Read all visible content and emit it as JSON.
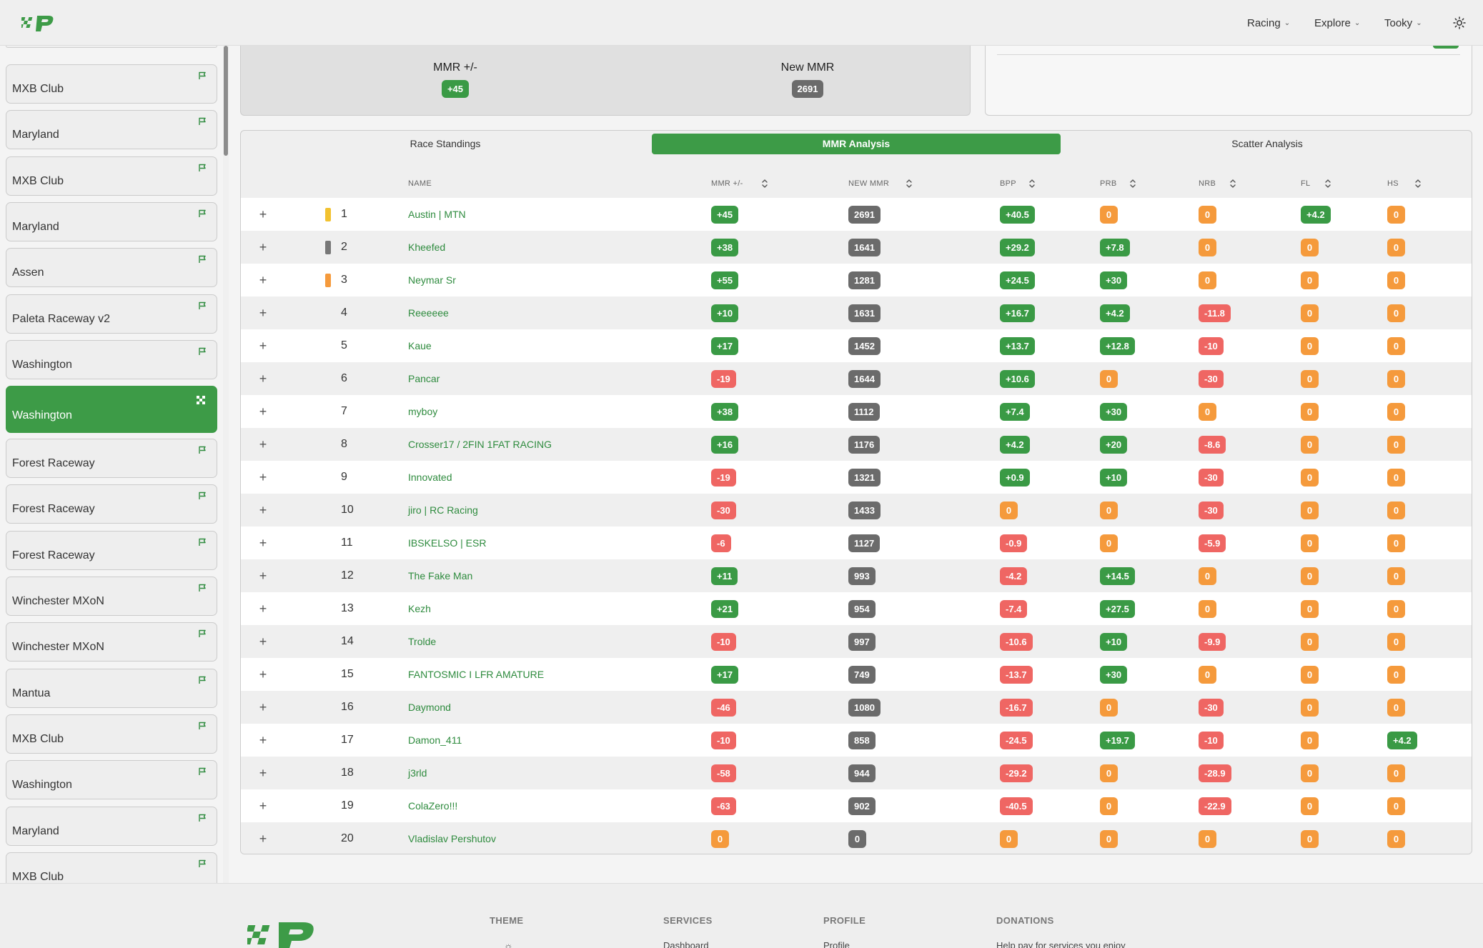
{
  "navbar": {
    "menu": [
      {
        "label": "Racing"
      },
      {
        "label": "Explore"
      },
      {
        "label": "Tooky"
      }
    ],
    "theme_icon": "sun-icon",
    "logo_icon": "checkered-p-logo"
  },
  "sidebar": {
    "tracks": [
      {
        "name": "MXB Club",
        "icon": "flag-icon"
      },
      {
        "name": "Maryland",
        "icon": "flag-icon"
      },
      {
        "name": "MXB Club",
        "icon": "flag-icon"
      },
      {
        "name": "Maryland",
        "icon": "flag-icon"
      },
      {
        "name": "Assen",
        "icon": "flag-icon"
      },
      {
        "name": "Paleta Raceway v2",
        "icon": "flag-icon"
      },
      {
        "name": "Washington",
        "icon": "flag-icon"
      },
      {
        "name": "Washington",
        "icon": "checkered-flag-icon",
        "active": true
      },
      {
        "name": "Forest Raceway",
        "icon": "flag-icon"
      },
      {
        "name": "Forest Raceway",
        "icon": "flag-icon"
      },
      {
        "name": "Forest Raceway",
        "icon": "flag-icon"
      },
      {
        "name": "Winchester MXoN",
        "icon": "flag-icon"
      },
      {
        "name": "Winchester MXoN",
        "icon": "flag-icon"
      },
      {
        "name": "Mantua",
        "icon": "flag-icon"
      },
      {
        "name": "MXB Club",
        "icon": "flag-icon"
      },
      {
        "name": "Washington",
        "icon": "flag-icon"
      },
      {
        "name": "Maryland",
        "icon": "flag-icon"
      },
      {
        "name": "MXB Club",
        "icon": "flag-icon"
      }
    ]
  },
  "summary": {
    "mmr_change_label": "MMR +/-",
    "mmr_change_value": "+45",
    "new_mmr_label": "New MMR",
    "new_mmr_value": "2691"
  },
  "tabs": [
    {
      "label": "Race Standings"
    },
    {
      "label": "MMR Analysis",
      "active": true
    },
    {
      "label": "Scatter Analysis"
    }
  ],
  "table": {
    "headers": {
      "name": "NAME",
      "mmr_change": "MMR +/-",
      "new_mmr": "NEW MMR",
      "bpp": "BPP",
      "prb": "PRB",
      "nrb": "NRB",
      "fl": "FL",
      "hs": "HS"
    },
    "expand_symbol": "+",
    "rows": [
      {
        "pos": "1",
        "marker": "#f2c230",
        "name": "Austin | MTN",
        "mmr": "+45",
        "new": "2691",
        "bpp": "+40.5",
        "prb": "0",
        "nrb": "0",
        "fl": "+4.2",
        "hs": "0"
      },
      {
        "pos": "2",
        "marker": "#777777",
        "name": "Kheefed",
        "mmr": "+38",
        "new": "1641",
        "bpp": "+29.2",
        "prb": "+7.8",
        "nrb": "0",
        "fl": "0",
        "hs": "0"
      },
      {
        "pos": "3",
        "marker": "#f59a3c",
        "name": "Neymar Sr",
        "mmr": "+55",
        "new": "1281",
        "bpp": "+24.5",
        "prb": "+30",
        "nrb": "0",
        "fl": "0",
        "hs": "0"
      },
      {
        "pos": "4",
        "marker": "",
        "name": "Reeeeee",
        "mmr": "+10",
        "new": "1631",
        "bpp": "+16.7",
        "prb": "+4.2",
        "nrb": "-11.8",
        "fl": "0",
        "hs": "0"
      },
      {
        "pos": "5",
        "marker": "",
        "name": "Kaue",
        "mmr": "+17",
        "new": "1452",
        "bpp": "+13.7",
        "prb": "+12.8",
        "nrb": "-10",
        "fl": "0",
        "hs": "0"
      },
      {
        "pos": "6",
        "marker": "",
        "name": "Pancar",
        "mmr": "-19",
        "new": "1644",
        "bpp": "+10.6",
        "prb": "0",
        "nrb": "-30",
        "fl": "0",
        "hs": "0"
      },
      {
        "pos": "7",
        "marker": "",
        "name": "myboy",
        "mmr": "+38",
        "new": "1112",
        "bpp": "+7.4",
        "prb": "+30",
        "nrb": "0",
        "fl": "0",
        "hs": "0"
      },
      {
        "pos": "8",
        "marker": "",
        "name": "Crosser17 / 2FIN 1FAT RACING",
        "mmr": "+16",
        "new": "1176",
        "bpp": "+4.2",
        "prb": "+20",
        "nrb": "-8.6",
        "fl": "0",
        "hs": "0"
      },
      {
        "pos": "9",
        "marker": "",
        "name": "Innovated",
        "mmr": "-19",
        "new": "1321",
        "bpp": "+0.9",
        "prb": "+10",
        "nrb": "-30",
        "fl": "0",
        "hs": "0"
      },
      {
        "pos": "10",
        "marker": "",
        "name": "jiro | RC Racing",
        "mmr": "-30",
        "new": "1433",
        "bpp": "0",
        "prb": "0",
        "nrb": "-30",
        "fl": "0",
        "hs": "0"
      },
      {
        "pos": "11",
        "marker": "",
        "name": "IBSKELSO | ESR",
        "mmr": "-6",
        "new": "1127",
        "bpp": "-0.9",
        "prb": "0",
        "nrb": "-5.9",
        "fl": "0",
        "hs": "0"
      },
      {
        "pos": "12",
        "marker": "",
        "name": "The Fake Man",
        "mmr": "+11",
        "new": "993",
        "bpp": "-4.2",
        "prb": "+14.5",
        "nrb": "0",
        "fl": "0",
        "hs": "0"
      },
      {
        "pos": "13",
        "marker": "",
        "name": "Kezh",
        "mmr": "+21",
        "new": "954",
        "bpp": "-7.4",
        "prb": "+27.5",
        "nrb": "0",
        "fl": "0",
        "hs": "0"
      },
      {
        "pos": "14",
        "marker": "",
        "name": "Trolde",
        "mmr": "-10",
        "new": "997",
        "bpp": "-10.6",
        "prb": "+10",
        "nrb": "-9.9",
        "fl": "0",
        "hs": "0"
      },
      {
        "pos": "15",
        "marker": "",
        "name": "FANTOSMIC I LFR AMATURE",
        "mmr": "+17",
        "new": "749",
        "bpp": "-13.7",
        "prb": "+30",
        "nrb": "0",
        "fl": "0",
        "hs": "0"
      },
      {
        "pos": "16",
        "marker": "",
        "name": "Daymond",
        "mmr": "-46",
        "new": "1080",
        "bpp": "-16.7",
        "prb": "0",
        "nrb": "-30",
        "fl": "0",
        "hs": "0"
      },
      {
        "pos": "17",
        "marker": "",
        "name": "Damon_411",
        "mmr": "-10",
        "new": "858",
        "bpp": "-24.5",
        "prb": "+19.7",
        "nrb": "-10",
        "fl": "0",
        "hs": "+4.2"
      },
      {
        "pos": "18",
        "marker": "",
        "name": "j3rld",
        "mmr": "-58",
        "new": "944",
        "bpp": "-29.2",
        "prb": "0",
        "nrb": "-28.9",
        "fl": "0",
        "hs": "0"
      },
      {
        "pos": "19",
        "marker": "",
        "name": "ColaZero!!!",
        "mmr": "-63",
        "new": "902",
        "bpp": "-40.5",
        "prb": "0",
        "nrb": "-22.9",
        "fl": "0",
        "hs": "0"
      },
      {
        "pos": "20",
        "marker": "",
        "name": "Vladislav Pershutov",
        "mmr": "0",
        "new": "0",
        "bpp": "0",
        "prb": "0",
        "nrb": "0",
        "fl": "0",
        "hs": "0"
      }
    ]
  },
  "footer": {
    "columns": [
      {
        "heading": "THEME",
        "link": ""
      },
      {
        "heading": "SERVICES",
        "link": "Dashboard"
      },
      {
        "heading": "PROFILE",
        "link": "Profile"
      },
      {
        "heading": "DONATIONS",
        "link": "Help pay for services you enjoy"
      }
    ],
    "logo_icon": "checkered-p-logo"
  },
  "colors": {
    "accent_green": "#3d9b47",
    "badge_positive": "#3a9a45",
    "badge_negative": "#ef6663",
    "badge_zero": "#f59a3c",
    "badge_mmr": "#6b6b6b"
  }
}
